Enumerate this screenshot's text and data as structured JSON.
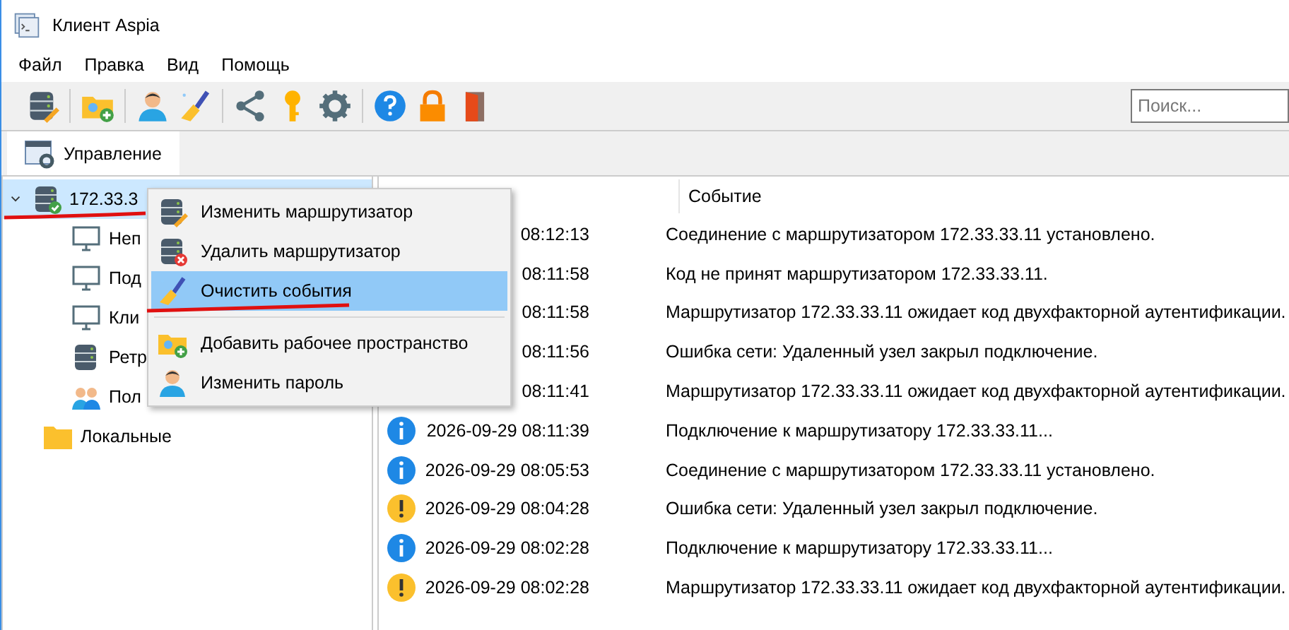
{
  "window": {
    "title": "Клиент Aspia"
  },
  "menu_bar": [
    "Файл",
    "Правка",
    "Вид",
    "Помощь"
  ],
  "search": {
    "placeholder": "Поиск..."
  },
  "tabs": [
    {
      "label": "Управление",
      "selected": true
    }
  ],
  "tree": [
    {
      "label": "172.33.3",
      "selected": true,
      "expanded": true,
      "children": [
        {
          "label": "Неп",
          "selected": false
        },
        {
          "label": "Под",
          "selected": false
        },
        {
          "label": "Кли",
          "selected": false
        },
        {
          "label": "Ретр",
          "selected": false
        },
        {
          "label": "Пол",
          "selected": false
        }
      ]
    },
    {
      "label": "Локальные",
      "selected": false
    }
  ],
  "table": {
    "columns": [
      "Событие"
    ],
    "rows": [
      {
        "time": "08:12:13",
        "event": "Соединение с маршрутизатором 172.33.33.11 установлено."
      },
      {
        "time": "08:11:58",
        "event": "Код не принят маршрутизатором 172.33.33.11."
      },
      {
        "time": "08:11:58",
        "event": "Маршрутизатор 172.33.33.11 ожидает код двухфакторной аутентификации."
      },
      {
        "time": "08:11:56",
        "event": "Ошибка сети: Удаленный узел закрыл подключение."
      },
      {
        "time": "08:11:41",
        "event": "Маршрутизатор 172.33.33.11 ожидает код двухфакторной аутентификации."
      },
      {
        "kind": "info",
        "time": "2026-09-29 08:11:39",
        "event": "Подключение к маршрутизатору 172.33.33.11..."
      },
      {
        "kind": "info",
        "time": "2026-09-29 08:05:53",
        "event": "Соединение с маршрутизатором 172.33.33.11 установлено."
      },
      {
        "kind": "warning",
        "time": "2026-09-29 08:04:28",
        "event": "Ошибка сети: Удаленный узел закрыл подключение."
      },
      {
        "kind": "info",
        "time": "2026-09-29 08:02:28",
        "event": "Подключение к маршрутизатору 172.33.33.11..."
      },
      {
        "kind": "warning",
        "time": "2026-09-29 08:02:28",
        "event": "Маршрутизатор 172.33.33.11 ожидает код двухфакторной аутентификации."
      }
    ]
  },
  "context_menu": {
    "items": [
      {
        "kind": "item",
        "label": "Изменить маршрутизатор",
        "selected": false
      },
      {
        "kind": "item",
        "label": "Удалить маршрутизатор",
        "selected": false
      },
      {
        "kind": "item",
        "label": "Очистить события",
        "selected": true
      },
      {
        "kind": "separator"
      },
      {
        "kind": "item",
        "label": "Добавить рабочее пространство",
        "selected": false
      },
      {
        "kind": "item",
        "label": "Изменить пароль",
        "selected": false
      }
    ]
  }
}
